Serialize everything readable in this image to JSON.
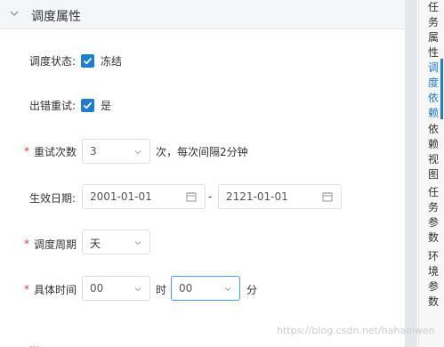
{
  "section": {
    "title": "调度属性"
  },
  "form": {
    "dispatch_status": {
      "label": "调度状态:",
      "checkbox_label": "冻结",
      "checked": true
    },
    "retry_on_error": {
      "label": "出错重试:",
      "checkbox_label": "是",
      "checked": true
    },
    "retry_count": {
      "label": "重试次数",
      "value": "3",
      "suffix": "次，每次间隔2分钟",
      "required": true
    },
    "effective_date": {
      "label": "生效日期:",
      "start": "2001-01-01",
      "separator": "-",
      "end": "2121-01-01"
    },
    "dispatch_cycle": {
      "label": "调度周期",
      "value": "天",
      "required": true
    },
    "exec_time": {
      "label": "具体时间",
      "hour": "00",
      "hour_unit": "时",
      "minute": "00",
      "minute_unit": "分",
      "required": true
    },
    "required_mark": "*",
    "bottom_cut_text": "..."
  },
  "tabs": [
    {
      "label": "任务属性",
      "active": false
    },
    {
      "label": "调度依赖",
      "active": true
    },
    {
      "label": "依赖视图",
      "active": false
    },
    {
      "label": "任务参数",
      "active": false
    },
    {
      "label": "环境参数",
      "active": false
    }
  ],
  "watermark": "https://blog.csdn.net/hahaeiwen",
  "colors": {
    "accent": "#1d7dd2",
    "required": "#e33333",
    "border": "#dcdfe6"
  }
}
